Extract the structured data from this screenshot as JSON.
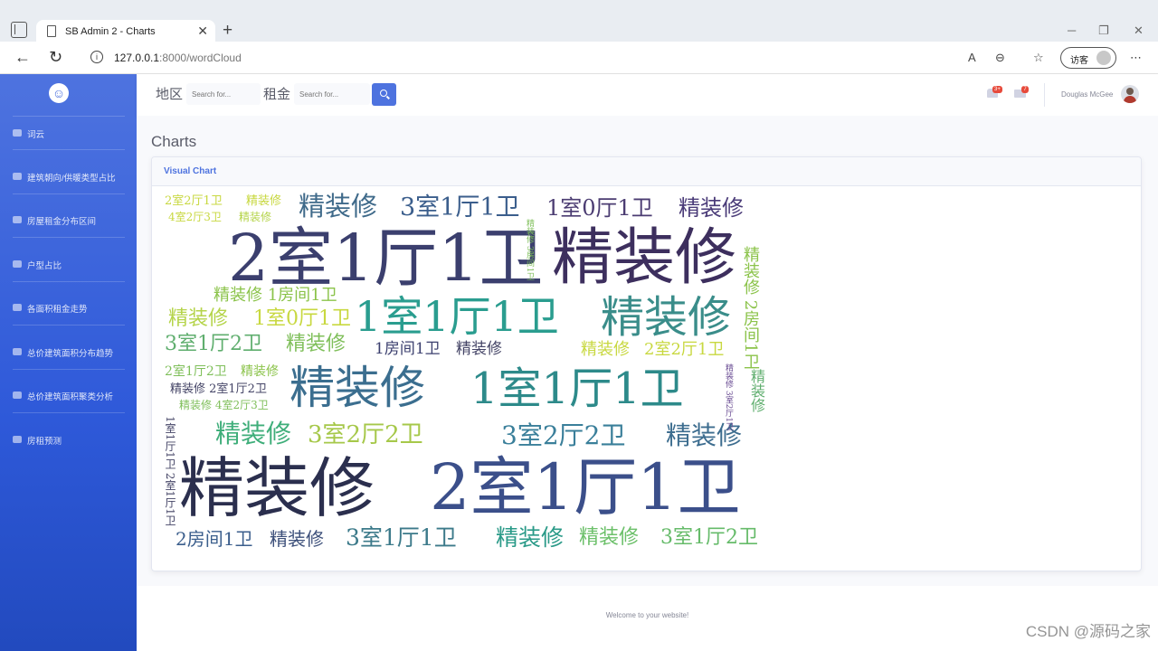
{
  "browser": {
    "tab_title": "SB Admin 2 - Charts",
    "url_host": "127.0.0.1",
    "url_rest": ":8000/wordCloud",
    "guest_label": "访客"
  },
  "sidebar": {
    "items": [
      {
        "label": "词云"
      },
      {
        "label": "建筑朝向/供暖类型占比"
      },
      {
        "label": "房屋租金分布区间"
      },
      {
        "label": "户型占比"
      },
      {
        "label": "各面积租金走势"
      },
      {
        "label": "总价建筑面积分布趋势"
      },
      {
        "label": "总价建筑面积聚类分析"
      },
      {
        "label": "房租预测"
      }
    ]
  },
  "topbar": {
    "region_label": "地区",
    "region_placeholder": "Search for...",
    "rent_label": "租金",
    "rent_placeholder": "Search for...",
    "alerts_count": "3+",
    "messages_count": "7",
    "user_name": "Douglas McGee"
  },
  "main": {
    "page_title": "Charts",
    "card_title": "Visual Chart"
  },
  "wordcloud": {
    "words": [
      {
        "text": "2室1厅1卫",
        "color": "#3b3f6e"
      },
      {
        "text": "精装修",
        "color": "#3d2f5e"
      },
      {
        "text": "1室1厅1卫",
        "color": "#2a9d8f"
      },
      {
        "text": "精装修",
        "color": "#3a8d8a"
      },
      {
        "text": "精装修",
        "color": "#3b6e8f"
      },
      {
        "text": "1室1厅1卫",
        "color": "#2d8a8a"
      },
      {
        "text": "精装修",
        "color": "#2b2f4e"
      },
      {
        "text": "2室1厅1卫",
        "color": "#3b4f8a"
      },
      {
        "text": "精装修",
        "color": "#3f6a8a"
      },
      {
        "text": "3室1厅1卫",
        "color": "#3b5e8c"
      },
      {
        "text": "1室0厅1卫",
        "color": "#4b3c72"
      },
      {
        "text": "精装修",
        "color": "#4a3b78"
      },
      {
        "text": "精装修",
        "color": "#3fae7a"
      },
      {
        "text": "3室2厅2卫",
        "color": "#a6c84a"
      },
      {
        "text": "3室2厅2卫",
        "color": "#3a7f9a"
      },
      {
        "text": "精装修",
        "color": "#3d6d8f"
      },
      {
        "text": "3室1厅1卫",
        "color": "#3c7a8a"
      },
      {
        "text": "精装修",
        "color": "#2a9a88"
      },
      {
        "text": "精装修",
        "color": "#6cc06a"
      },
      {
        "text": "3室1厅2卫",
        "color": "#66bb6a"
      },
      {
        "text": "2房间1卫",
        "color": "#3b5e8c"
      },
      {
        "text": "精装修",
        "color": "#3c4f7a"
      },
      {
        "text": "精装修",
        "color": "#b5d44a"
      },
      {
        "text": "1室0厅1卫",
        "color": "#c8d840"
      },
      {
        "text": "精装修 1房间1卫",
        "color": "#8bc34a"
      },
      {
        "text": "3室1厅2卫",
        "color": "#5fae6e"
      },
      {
        "text": "精装修",
        "color": "#7fbf5a"
      },
      {
        "text": "1房间1卫",
        "color": "#3b3f6e"
      },
      {
        "text": "精装修",
        "color": "#444466"
      },
      {
        "text": "精装修",
        "color": "#c8d840"
      },
      {
        "text": "2室2厅1卫",
        "color": "#c8d840"
      },
      {
        "text": "2室1厅2卫",
        "color": "#7fbf5a"
      },
      {
        "text": "精装修",
        "color": "#8bc34a"
      },
      {
        "text": "精装修 2室1厅2卫",
        "color": "#444466"
      },
      {
        "text": "精装修 4室2厅3卫",
        "color": "#7fbf5a"
      },
      {
        "text": "2室2厅1卫",
        "color": "#c8d840"
      },
      {
        "text": "精装修",
        "color": "#c8d840"
      },
      {
        "text": "4室2厅3卫",
        "color": "#c8d840"
      },
      {
        "text": "精装修",
        "color": "#b5d44a"
      },
      {
        "text": "精装修 2房间1卫",
        "color": "#8bc34a"
      },
      {
        "text": "精装修",
        "color": "#5fae6e"
      },
      {
        "text": "1室1厅1卫 2室1厅1卫",
        "color": "#444466"
      },
      {
        "text": "精装修 3室2厅1卫",
        "color": "#6a4c93"
      },
      {
        "text": "精装修 3房间1卫",
        "color": "#7fbf5a"
      }
    ]
  },
  "footer": {
    "text": "Welcome to your website!"
  },
  "watermark": "CSDN @源码之家"
}
